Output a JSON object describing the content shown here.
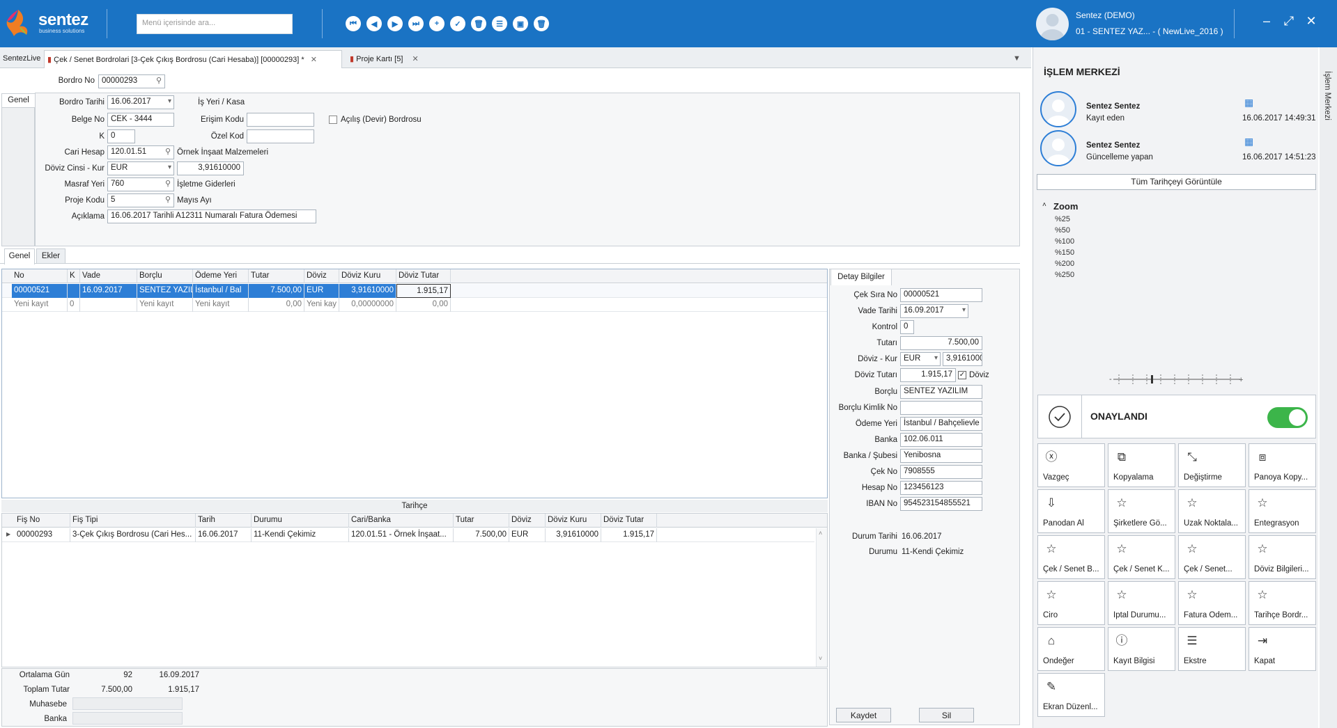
{
  "topbar": {
    "logo": "sentez",
    "logo_sub": "business solutions",
    "search_placeholder": "Menü içerisinde ara...",
    "user_name": "Sentez (DEMO)",
    "user_company": "01 - SENTEZ YAZ... - ( NewLive_2016 )"
  },
  "tabs": {
    "home": "SentezLive",
    "active": "Çek / Senet Bordrolari [3-Çek Çıkış Bordrosu (Cari Hesaba)]  [00000293] *",
    "second": "Proje Kartı [5]"
  },
  "form": {
    "bordro_no_label": "Bordro No",
    "bordro_no": "00000293",
    "genel_tab": "Genel",
    "bordro_tarihi_label": "Bordro Tarihi",
    "bordro_tarihi": "16.06.2017",
    "isyeri_label": "İş Yeri / Kasa",
    "belge_no_label": "Belge No",
    "belge_no": "CEK - 3444",
    "erisim_kodu_label": "Erişim Kodu",
    "erisim_kodu": "",
    "acilis_label": "Açılış (Devir) Bordrosu",
    "k_label": "K",
    "k_value": "0",
    "ozel_kod_label": "Özel Kod",
    "ozel_kod": "",
    "cari_hesap_label": "Cari Hesap",
    "cari_hesap": "120.01.51",
    "cari_hesap_name": "Örnek İnşaat Malzemeleri",
    "doviz_label": "Döviz Cinsi - Kur",
    "doviz": "EUR",
    "kur": "3,91610000",
    "masraf_label": "Masraf Yeri",
    "masraf": "760",
    "masraf_name": "İşletme Giderleri",
    "proje_label": "Proje Kodu",
    "proje": "5",
    "proje_name": "Mayıs Ayı",
    "aciklama_label": "Açıklama",
    "aciklama": "16.06.2017 Tarihli A12311 Numaralı Fatura Ödemesi"
  },
  "subtabs": [
    "Genel",
    "Ekler"
  ],
  "grid": {
    "columns": [
      "No",
      "K",
      "Vade",
      "Borçlu",
      "Ödeme Yeri",
      "Tutar",
      "Döviz",
      "Döviz Kuru",
      "Döviz Tutar"
    ],
    "rows": [
      [
        "00000521",
        "",
        "16.09.2017",
        "SENTEZ YAZIL",
        "İstanbul  / Bal",
        "7.500,00",
        "EUR",
        "3,91610000",
        "1.915,17"
      ],
      [
        "Yeni kayıt",
        "0",
        "",
        "Yeni kayıt",
        "Yeni kayıt",
        "0,00",
        "Yeni kay",
        "0,00000000",
        "0,00"
      ]
    ]
  },
  "history": {
    "title": "Tarihçe",
    "columns": [
      "Fiş No",
      "Fiş Tipi",
      "Tarih",
      "Durumu",
      "Cari/Banka",
      "Tutar",
      "Döviz",
      "Döviz Kuru",
      "Döviz Tutar"
    ],
    "rows": [
      [
        "00000293",
        "3-Çek Çıkış Bordrosu (Cari Hes...",
        "16.06.2017",
        "11-Kendi Çekimiz",
        "120.01.51 - Örnek İnşaat...",
        "7.500,00",
        "EUR",
        "3,91610000",
        "1.915,17"
      ]
    ]
  },
  "summary": {
    "ort_label": "Ortalama Gün",
    "ort_value": "92",
    "ort_date": "16.09.2017",
    "top_label": "Toplam Tutar",
    "top_value": "7.500,00",
    "top_doviz": "1.915,17",
    "muhasebe_label": "Muhasebe",
    "banka_label": "Banka"
  },
  "detail": {
    "tab": "Detay Bilgiler",
    "cek_sira_label": "Çek Sıra No",
    "cek_sira": "00000521",
    "vade_label": "Vade Tarihi",
    "vade": "16.09.2017",
    "kontrol_label": "Kontrol",
    "kontrol": "0",
    "tutar_label": "Tutarı",
    "tutar": "7.500,00",
    "dk_label": "Döviz - Kur",
    "dk_doviz": "EUR",
    "dk_kur": "3,9161000",
    "dt_label": "Döviz Tutarı",
    "dt": "1.915,17",
    "dt_check": "Döviz",
    "borclu_label": "Borçlu",
    "borclu": "SENTEZ YAZILIM",
    "kimlik_label": "Borçlu Kimlik No",
    "kimlik": "",
    "odeme_label": "Ödeme Yeri",
    "odeme": "İstanbul  / Bahçelievle",
    "banka_label": "Banka",
    "banka": "102.06.011",
    "sube_label": "Banka / Şubesi",
    "sube": "Yenibosna",
    "cekno_label": "Çek No",
    "cekno": "7908555",
    "hesap_label": "Hesap No",
    "hesap": "123456123",
    "iban_label": "IBAN No",
    "iban": "954523154855521",
    "durum_tarihi_label": "Durum Tarihi",
    "durum_tarihi": "16.06.2017",
    "durum_label": "Durumu",
    "durum": "11-Kendi Çekimiz",
    "kaydet": "Kaydet",
    "sil": "Sil"
  },
  "side": {
    "title": "İŞLEM MERKEZİ",
    "vertical": "İşlem Merkezi",
    "entries": [
      {
        "name": "Sentez Sentez",
        "role": "Kayıt eden",
        "date": "16.06.2017 14:49:31"
      },
      {
        "name": "Sentez Sentez",
        "role": "Güncelleme yapan",
        "date": "16.06.2017 14:51:23"
      }
    ],
    "history_button": "Tüm Tarihçeyi Görüntüle",
    "zoom_title": "Zoom",
    "zoom_items": [
      "%25",
      "%50",
      "%100",
      "%150",
      "%200",
      "%250"
    ],
    "status": "ONAYLANDI",
    "actions": [
      "Vazgeç",
      "Kopyalama",
      "Değiştirme",
      "Panoya Kopy...",
      "Panodan Al",
      "Şirketlere Gö...",
      "Uzak Noktala...",
      "Entegrasyon",
      "Çek / Senet B...",
      "Çek / Senet K...",
      "Çek / Senet...",
      "Döviz Bilgileri...",
      "Ciro",
      "İptal Durumu...",
      "Fatura Ödem...",
      "Tarihçe Bordr...",
      "Öndeğer",
      "Kayıt Bilgisi",
      "Ekstre",
      "Kapat",
      "Ekran Düzenl..."
    ],
    "action_icons": [
      "ⓧ",
      "⧉",
      "⤡",
      "⧈",
      "⇩",
      "☆",
      "☆",
      "☆",
      "☆",
      "☆",
      "☆",
      "☆",
      "☆",
      "☆",
      "☆",
      "☆",
      "⌂",
      "ⓘ",
      "☰",
      "⇥",
      "✎"
    ]
  }
}
